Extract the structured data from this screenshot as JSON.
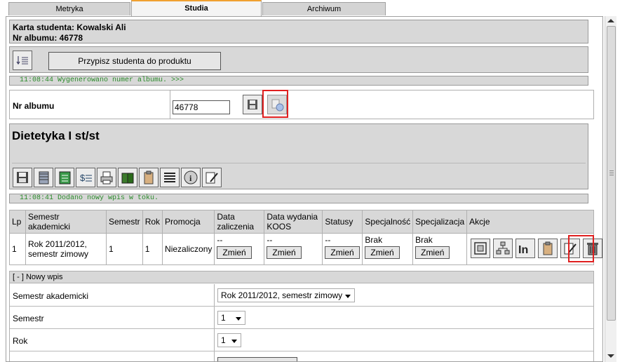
{
  "tabs": [
    {
      "label": "Metryka"
    },
    {
      "label": "Studia"
    },
    {
      "label": "Archiwum"
    }
  ],
  "student": {
    "card_title": "Karta studenta: Kowalski Ali",
    "album_line": "Nr albumu: 46778"
  },
  "toolbar": {
    "assign_button": "Przypisz studenta do produktu"
  },
  "logs": {
    "first": "11:08:44 Wygenerowano numer albumu. >>>",
    "second": "11:08:41 Dodano nowy wpis w toku."
  },
  "album_form": {
    "label": "Nr albumu",
    "value": "46778"
  },
  "program": {
    "title": "Dietetyka I st/st"
  },
  "table": {
    "headers": [
      "Lp",
      "Semestr akademicki",
      "Semestr",
      "Rok",
      "Promocja",
      "Data zaliczenia",
      "Data wydania KOOS",
      "Statusy",
      "Specjalność",
      "Specjalizacja",
      "Akcje"
    ],
    "row": {
      "lp": "1",
      "semestr_akademicki": "Rok 2011/2012, semestr zimowy",
      "semestr": "1",
      "rok": "1",
      "promocja": "Niezaliczony",
      "data_zaliczenia": "--",
      "data_koos": "--",
      "statusy": "--",
      "specjalnosc": "Brak",
      "specjalizacja": "Brak",
      "change_label": "Zmień"
    }
  },
  "new_entry": {
    "header": "[ - ] Nowy wpis",
    "semestr_akademicki_label": "Semestr akademicki",
    "semestr_akademicki_value": "Rok 2011/2012, semestr zimowy",
    "semestr_label": "Semestr",
    "semestr_value": "1",
    "rok_label": "Rok",
    "rok_value": "1"
  },
  "icons": {
    "sort": "sort-icon",
    "save": "floppy-icon",
    "generate": "generate-icon",
    "action_icons": [
      "floppy-icon",
      "notebook-icon",
      "ledger-icon",
      "money-icon",
      "printer-icon",
      "books-icon",
      "clipboard-icon",
      "list-icon",
      "info-icon",
      "edit-icon"
    ],
    "row_actions": [
      "frame-icon",
      "hierarchy-icon",
      "in-icon",
      "clipboard-icon",
      "edit-icon",
      "trash-icon"
    ]
  },
  "colors": {
    "highlight": "#e02020",
    "log_text": "#2a8a2a",
    "active_tab_accent": "#f0a030"
  }
}
